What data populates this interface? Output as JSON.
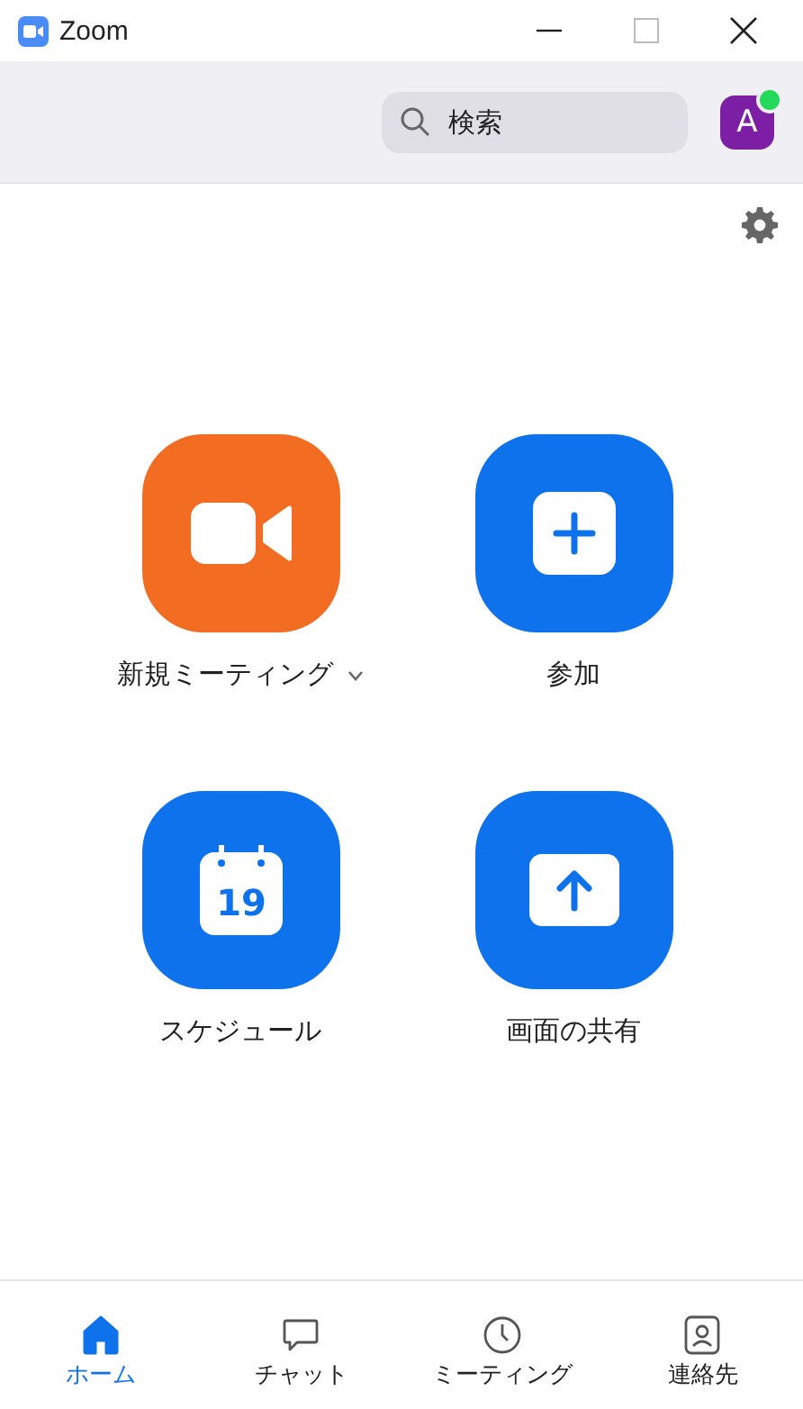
{
  "window": {
    "title": "Zoom"
  },
  "header": {
    "search": {
      "placeholder": "検索"
    },
    "avatar": {
      "initial": "A",
      "online": true
    }
  },
  "actions": [
    {
      "kind": "video",
      "label": "新規ミーティング",
      "color": "#f26d21",
      "dropdown": true
    },
    {
      "kind": "plus",
      "label": "参加",
      "color": "#0e72ed",
      "dropdown": false
    },
    {
      "kind": "calendar",
      "label": "スケジュール",
      "color": "#0e72ed",
      "dropdown": false,
      "day": "19"
    },
    {
      "kind": "share",
      "label": "画面の共有",
      "color": "#0e72ed",
      "dropdown": false
    }
  ],
  "nav": [
    {
      "kind": "home",
      "label": "ホーム",
      "selected": true
    },
    {
      "kind": "chat",
      "label": "チャット",
      "selected": false
    },
    {
      "kind": "clock",
      "label": "ミーティング",
      "selected": false
    },
    {
      "kind": "contacts",
      "label": "連絡先",
      "selected": false
    }
  ]
}
